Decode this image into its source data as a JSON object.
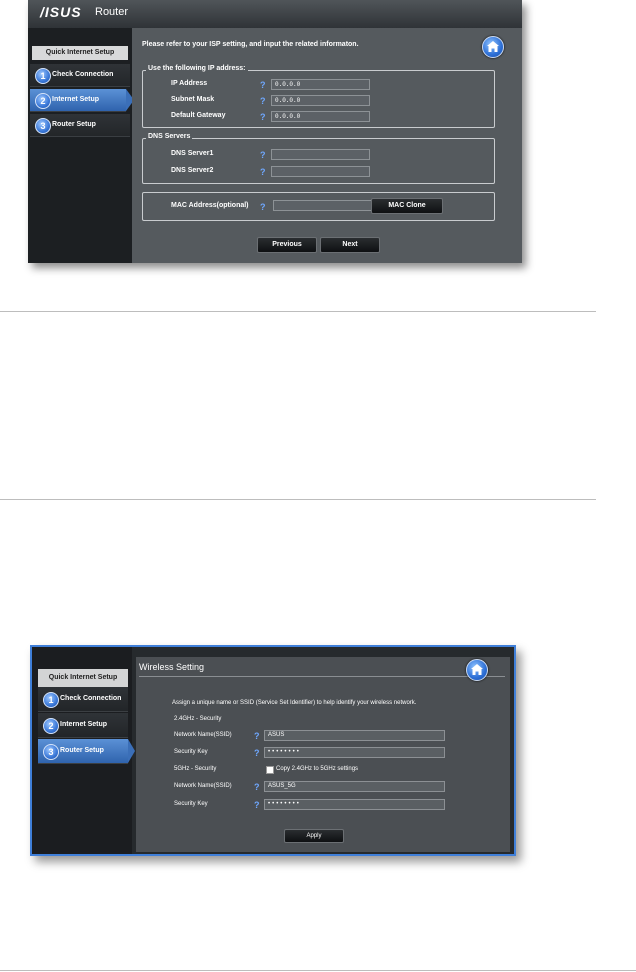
{
  "shot1": {
    "logo": "/ISUS",
    "app_title": "Router",
    "sidebar": {
      "header": "Quick Internet Setup",
      "items": [
        {
          "num": "1",
          "label": "Check Connection"
        },
        {
          "num": "2",
          "label": "Internet Setup",
          "active": true
        },
        {
          "num": "3",
          "label": "Router Setup"
        }
      ]
    },
    "instruction": "Please refer to your ISP setting, and input the related informaton.",
    "ip_group": {
      "legend": "Use the following IP address:",
      "fields": [
        {
          "label": "IP Address",
          "value": "0.0.0.0"
        },
        {
          "label": "Subnet Mask",
          "value": "0.0.0.0"
        },
        {
          "label": "Default Gateway",
          "value": "0.0.0.0"
        }
      ]
    },
    "dns_group": {
      "legend": "DNS Servers",
      "fields": [
        {
          "label": "DNS Server1",
          "value": ""
        },
        {
          "label": "DNS Server2",
          "value": ""
        }
      ]
    },
    "mac": {
      "label": "MAC Address(optional)",
      "value": "",
      "button": "MAC Clone"
    },
    "previous_button": "Previous",
    "next_button": "Next"
  },
  "shot2": {
    "sidebar": {
      "header": "Quick Internet Setup",
      "items": [
        {
          "num": "1",
          "label": "Check Connection"
        },
        {
          "num": "2",
          "label": "Internet Setup"
        },
        {
          "num": "3",
          "label": "Router Setup",
          "active": true
        }
      ]
    },
    "title": "Wireless Setting",
    "instruction": "Assign a unique name or SSID (Service Set Identifier) to help identify your wireless network.",
    "section_24": "2.4GHz - Security",
    "ssid_label_24": "Network Name(SSID)",
    "ssid_value_24": "ASUS",
    "key_label_24": "Security Key",
    "key_value_24": "••••••••",
    "section_5": "5GHz - Security",
    "copy_label": "Copy 2.4GHz to 5GHz settings",
    "ssid_label_5": "Network Name(SSID)",
    "ssid_value_5": "ASUS_5G",
    "key_label_5": "Security Key",
    "key_value_5": "••••••••",
    "apply_button": "Apply"
  },
  "colors": {
    "accent": "#3b6fb8",
    "panel": "#555a5e",
    "frame_border": "#3f7fd9"
  }
}
